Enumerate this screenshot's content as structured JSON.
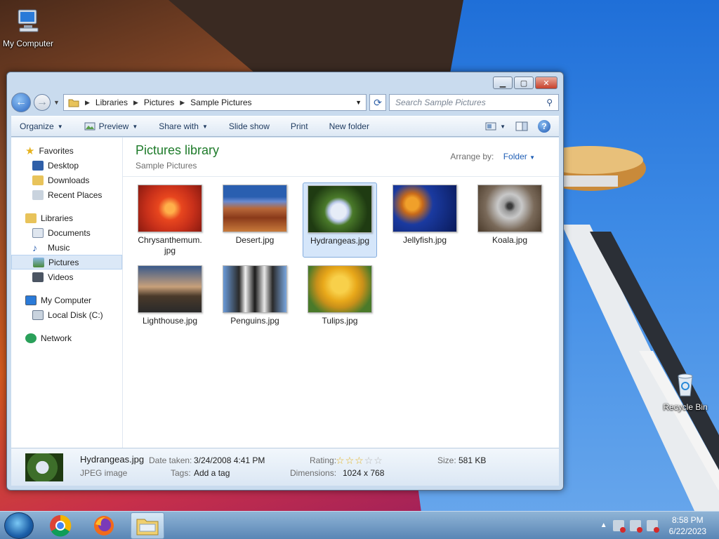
{
  "desktop": {
    "icons": [
      {
        "label": "My Computer"
      },
      {
        "label": "Recycle Bin"
      }
    ]
  },
  "window": {
    "address": {
      "crumbs": [
        "Libraries",
        "Pictures",
        "Sample Pictures"
      ]
    },
    "search_placeholder": "Search Sample Pictures",
    "toolbar": {
      "organize": "Organize",
      "preview": "Preview",
      "share_with": "Share with",
      "slide_show": "Slide show",
      "print": "Print",
      "new_folder": "New folder"
    },
    "nav": {
      "favorites": "Favorites",
      "desktop": "Desktop",
      "downloads": "Downloads",
      "recent_places": "Recent Places",
      "libraries": "Libraries",
      "documents": "Documents",
      "music": "Music",
      "pictures": "Pictures",
      "videos": "Videos",
      "my_computer": "My Computer",
      "local_disk": "Local Disk (C:)",
      "network": "Network"
    },
    "content": {
      "title": "Pictures library",
      "subtitle": "Sample Pictures",
      "arrange_label": "Arrange by:",
      "arrange_value": "Folder",
      "files": [
        {
          "name": "Chrysanthemum.jpg",
          "name_l1": "Chrysanthemum.",
          "name_l2": "jpg"
        },
        {
          "name": "Desert.jpg"
        },
        {
          "name": "Hydrangeas.jpg"
        },
        {
          "name": "Jellyfish.jpg"
        },
        {
          "name": "Koala.jpg"
        },
        {
          "name": "Lighthouse.jpg"
        },
        {
          "name": "Penguins.jpg"
        },
        {
          "name": "Tulips.jpg"
        }
      ]
    },
    "details": {
      "filename": "Hydrangeas.jpg",
      "filetype": "JPEG image",
      "date_label": "Date taken:",
      "date_value": "3/24/2008 4:41 PM",
      "tags_label": "Tags:",
      "tags_value": "Add a tag",
      "rating_label": "Rating:",
      "rating_value": 3,
      "rating_max": 5,
      "dimensions_label": "Dimensions:",
      "dimensions_value": "1024 x 768",
      "size_label": "Size:",
      "size_value": "581 KB"
    }
  },
  "taskbar": {
    "time": "8:58 PM",
    "date": "6/22/2023"
  },
  "colors": {
    "library_title": "#1e7b2a",
    "link_blue": "#1f5eb5",
    "selection": "#d5e6fa"
  }
}
